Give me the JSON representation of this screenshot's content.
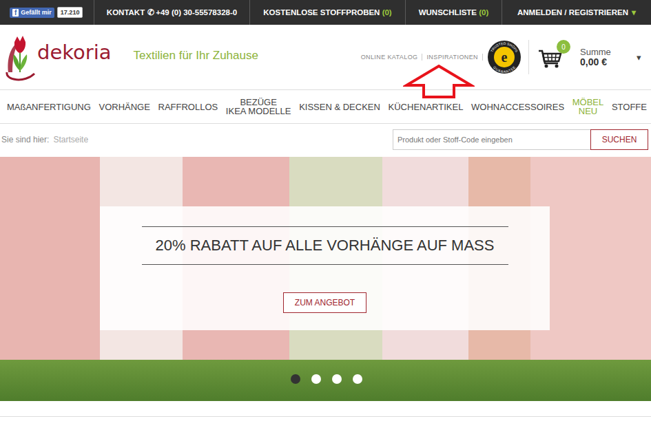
{
  "topbar": {
    "facebook": {
      "icon": "f",
      "label": "Gefällt mir",
      "count": "17.210"
    },
    "contact": {
      "label": "KONTAKT",
      "phone_icon": "✆",
      "phone": "+49 (0) 30-55578328-0"
    },
    "links": [
      {
        "label": "KOSTENLOSE STOFFPROBEN",
        "count": "(0)"
      },
      {
        "label": "WUNSCHLISTE",
        "count": "(0)"
      }
    ],
    "account": {
      "label": "ANMELDEN / REGISTRIEREN",
      "caret": "▾"
    }
  },
  "header": {
    "logo": "dekoria",
    "tagline": "Textilien für Ihr Zuhause",
    "links": [
      "ONLINE KATALOG",
      "INSPIRATIONEN"
    ],
    "trust_badge": {
      "letter": "e",
      "top": "TRUSTED SHOPS",
      "bottom": "GUARANTEE"
    },
    "cart": {
      "count": "0",
      "label": "Summe",
      "total": "0,00 €",
      "caret": "▾"
    }
  },
  "nav": [
    {
      "lines": [
        "MAßANFERTIGUNG"
      ],
      "highlight": false
    },
    {
      "lines": [
        "VORHÄNGE"
      ],
      "highlight": false
    },
    {
      "lines": [
        "RAFFROLLOS"
      ],
      "highlight": false
    },
    {
      "lines": [
        "BEZÜGE",
        "IKEA MODELLE"
      ],
      "highlight": false
    },
    {
      "lines": [
        "KISSEN & DECKEN"
      ],
      "highlight": false
    },
    {
      "lines": [
        "KÜCHENARTIKEL"
      ],
      "highlight": false
    },
    {
      "lines": [
        "WOHNACCESSOIRES"
      ],
      "highlight": false
    },
    {
      "lines": [
        "MÖBEL",
        "NEU"
      ],
      "highlight": true
    },
    {
      "lines": [
        "STOFFE"
      ],
      "highlight": false
    }
  ],
  "breadcrumb": {
    "label": "Sie sind hier:",
    "items": [
      "Startseite"
    ]
  },
  "search": {
    "placeholder": "Produkt oder Stoff-Code eingeben",
    "button": "SUCHEN"
  },
  "hero": {
    "headline": "20% RABATT AUF ALLE VORHÄNGE AUF MASS",
    "button": "ZUM ANGEBOT",
    "dots": [
      {
        "selected": true
      },
      {
        "selected": false
      },
      {
        "selected": false
      },
      {
        "selected": false
      }
    ]
  }
}
